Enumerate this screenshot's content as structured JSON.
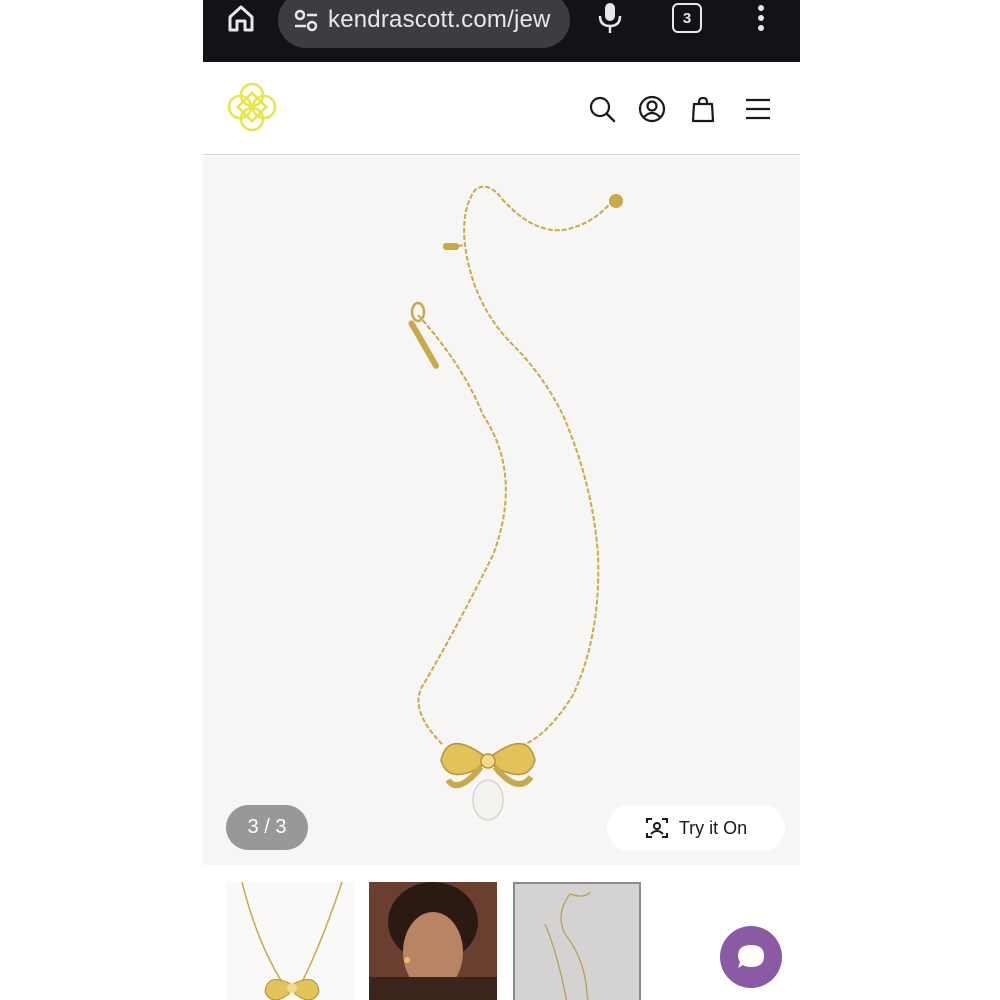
{
  "browser": {
    "url": "kendrascott.com/jew",
    "tab_count": "3"
  },
  "gallery": {
    "counter": "3 / 3",
    "try_on_label": "Try it On"
  },
  "colors": {
    "chrome_bg": "#111316",
    "logo_yellow": "#e9e64a",
    "gold": "#c9a94a",
    "chat_purple": "#8a5aa5"
  },
  "icons": {
    "header": [
      "search-icon",
      "account-icon",
      "shopping-bag-icon",
      "menu-icon"
    ],
    "chrome": [
      "home-icon",
      "site-settings-icon",
      "mic-icon",
      "tabs-icon",
      "more-icon"
    ]
  }
}
